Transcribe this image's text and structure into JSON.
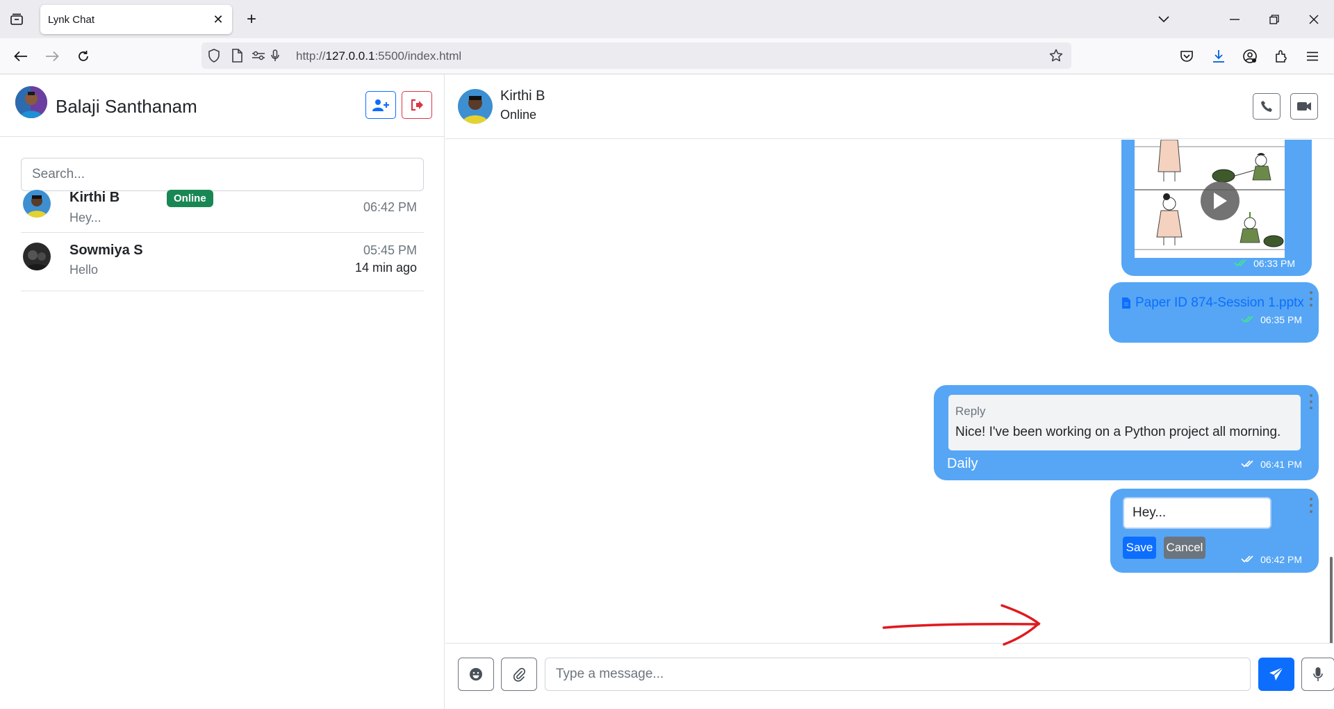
{
  "browser": {
    "tab_title": "Lynk Chat",
    "url_prefix": "http://",
    "url_host": "127.0.0.1",
    "url_rest": ":5500/index.html"
  },
  "sidebar": {
    "user_name": "Balaji Santhanam",
    "search_placeholder": "Search...",
    "contacts": [
      {
        "name": "Kirthi B",
        "badge": "Online",
        "last_message": "Hey...",
        "time": "06:42 PM",
        "ago": ""
      },
      {
        "name": "Sowmiya S",
        "badge": "",
        "last_message": "Hello",
        "time": "05:45 PM",
        "ago": "14 min ago"
      }
    ]
  },
  "chat": {
    "contact_name": "Kirthi B",
    "contact_status": "Online",
    "messages": [
      {
        "type": "video",
        "time": "06:33 PM",
        "read": true
      },
      {
        "type": "file",
        "file_name": "Paper ID 874-Session 1.pptx",
        "time": "06:35 PM",
        "read": true
      },
      {
        "type": "reply",
        "reply_label": "Reply",
        "reply_text": "Nice! I've been working on a Python project all morning.",
        "text": "Daily",
        "time": "06:41 PM",
        "read": false
      },
      {
        "type": "editing",
        "edit_value": "Hey...",
        "save_label": "Save",
        "cancel_label": "Cancel",
        "time": "06:42 PM",
        "read": false
      }
    ],
    "composer_placeholder": "Type a message..."
  },
  "colors": {
    "bubble": "#56a6f5",
    "primary": "#0d6efd",
    "danger": "#dc3545",
    "online_badge": "#198754",
    "read_ticks": "#3fe68b",
    "annotation_arrow": "#e0191e"
  }
}
